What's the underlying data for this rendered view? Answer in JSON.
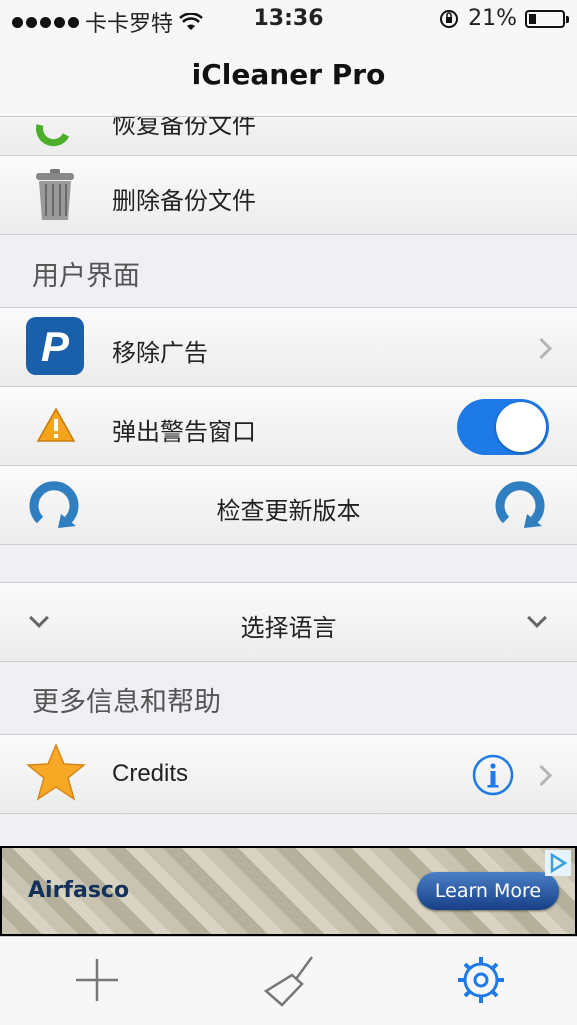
{
  "status": {
    "carrier": "卡卡罗特",
    "time": "13:36",
    "battery": "21%"
  },
  "nav": {
    "title": "iCleaner Pro"
  },
  "rows": {
    "restore_backup": "恢复备份文件",
    "delete_backup": "删除备份文件",
    "remove_ads": "移除广告",
    "popup_warning": "弹出警告窗口",
    "check_update": "检查更新版本",
    "select_language": "选择语言",
    "credits": "Credits"
  },
  "sections": {
    "ui": "用户界面",
    "more": "更多信息和帮助"
  },
  "popup_warning_enabled": true,
  "ad": {
    "brand": "Airfasco",
    "button": "Learn More"
  },
  "tabbar": {
    "items": [
      {
        "icon": "plus-icon"
      },
      {
        "icon": "broom-icon"
      },
      {
        "icon": "gear-icon"
      }
    ]
  },
  "colors": {
    "accent": "#1e7ae6",
    "background": "#efeff4"
  }
}
